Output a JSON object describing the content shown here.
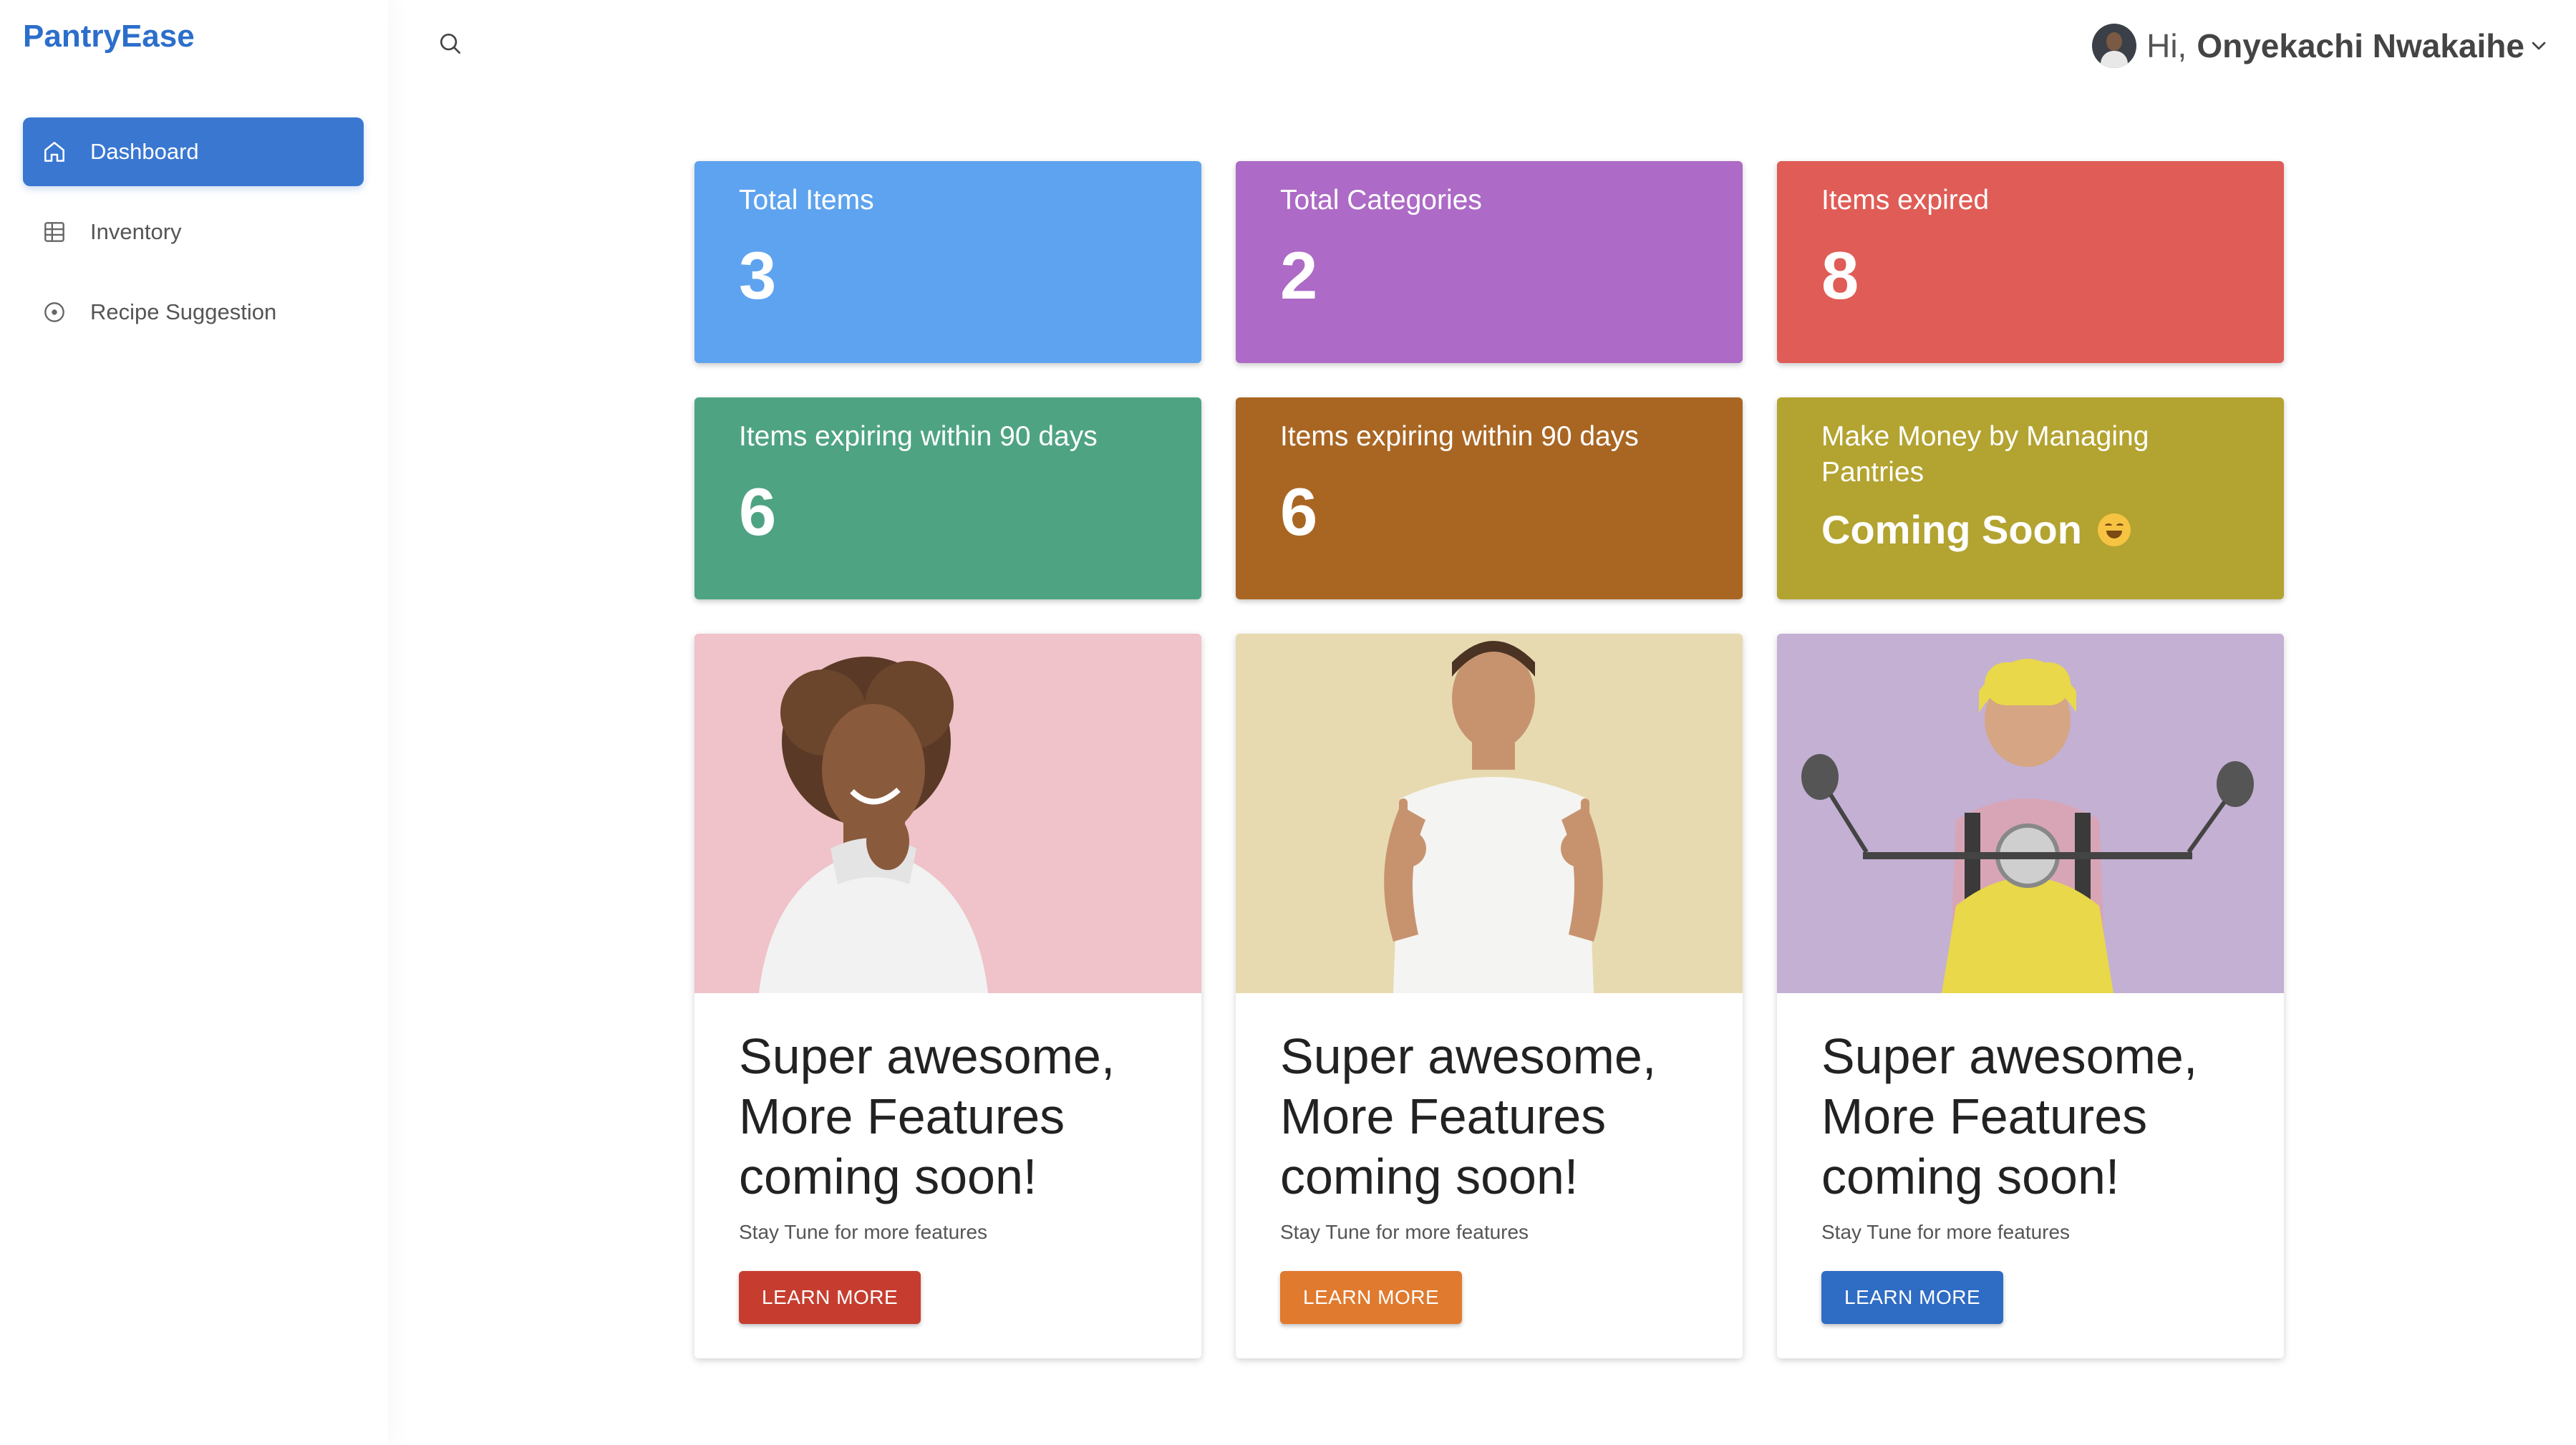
{
  "app": {
    "brand": "PantryEase"
  },
  "sidebar": {
    "items": [
      {
        "label": "Dashboard",
        "icon": "home-icon",
        "active": true
      },
      {
        "label": "Inventory",
        "icon": "table-icon",
        "active": false
      },
      {
        "label": "Recipe Suggestion",
        "icon": "circle-dot-icon",
        "active": false
      }
    ]
  },
  "header": {
    "greeting": "Hi,",
    "user_name": "Onyekachi Nwakaihe"
  },
  "stats": [
    {
      "label": "Total Items",
      "value": "3",
      "color": "#5ea3ef"
    },
    {
      "label": "Total Categories",
      "value": "2",
      "color": "#ad6ac6"
    },
    {
      "label": "Items expired",
      "value": "8",
      "color": "#e05c56"
    },
    {
      "label": "Items expiring within 90 days",
      "value": "6",
      "color": "#4ea383"
    },
    {
      "label": "Items expiring within 90 days",
      "value": "6",
      "color": "#a96623"
    },
    {
      "label": "Make Money by Managing Pantries",
      "value": "Coming Soon",
      "color": "#b3a330"
    }
  ],
  "features": [
    {
      "title": "Super awesome, More Features coming soon!",
      "subtitle": "Stay Tune for more features",
      "button": "LEARN MORE",
      "button_color": "#c63d2f"
    },
    {
      "title": "Super awesome, More Features coming soon!",
      "subtitle": "Stay Tune for more features",
      "button": "LEARN MORE",
      "button_color": "#e07a2e"
    },
    {
      "title": "Super awesome, More Features coming soon!",
      "subtitle": "Stay Tune for more features",
      "button": "LEARN MORE",
      "button_color": "#2f6cc4"
    }
  ]
}
